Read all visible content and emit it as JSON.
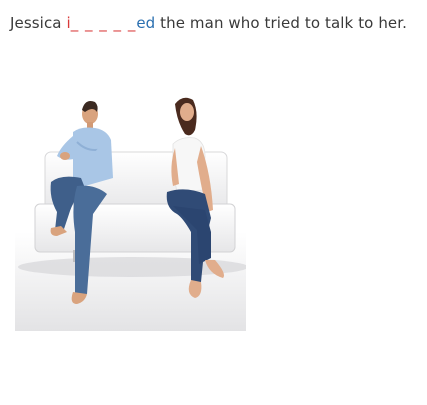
{
  "exercise": {
    "prefix": "Jessica ",
    "hint_letter": "i",
    "blanks": "_ _ _ _ _",
    "suffix_letters": "ed",
    "rest": " the man who tried to talk to her."
  },
  "colors": {
    "text": "#3a3a3a",
    "hint": "#d93a3a",
    "suffix": "#2a6fb0"
  }
}
